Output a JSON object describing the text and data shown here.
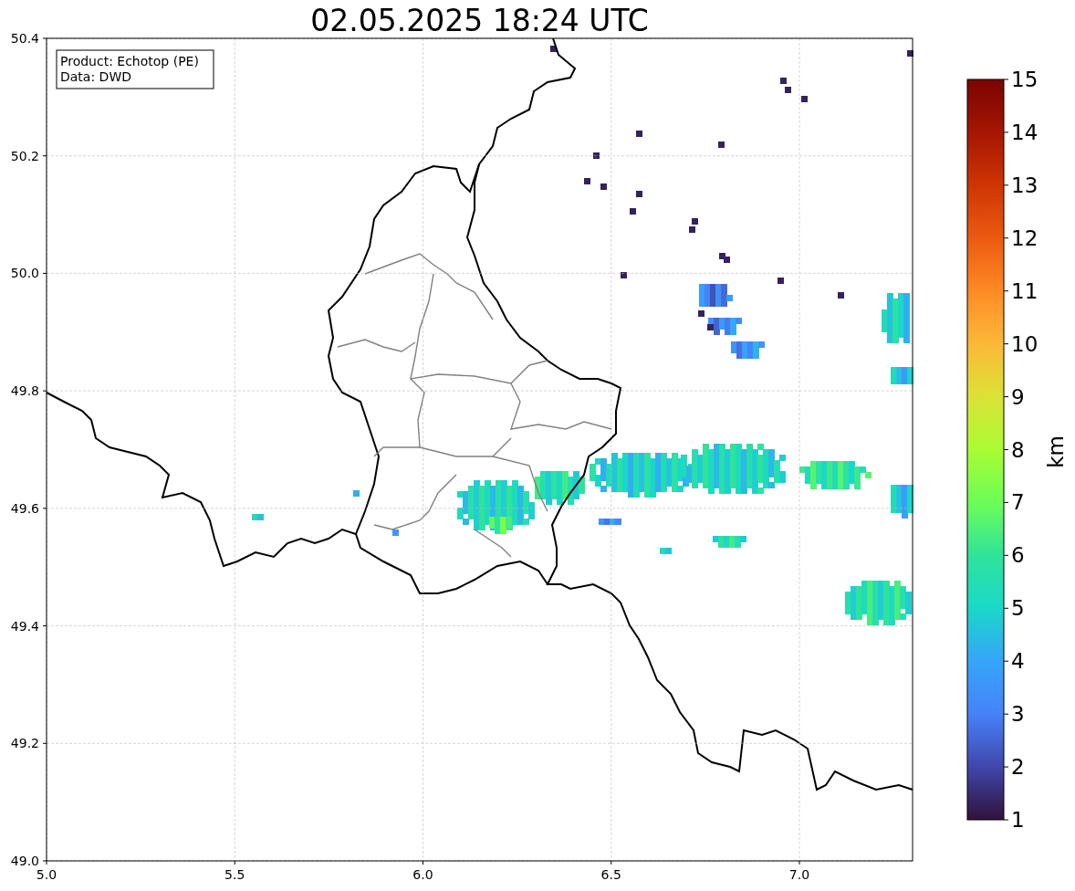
{
  "title": "02.05.2025 18:24 UTC",
  "info_box": {
    "lines": [
      "Product: Echotop (PE)",
      "Data: DWD"
    ]
  },
  "axes": {
    "xticks": [
      "5.0",
      "5.5",
      "6.0",
      "6.5",
      "7.0"
    ],
    "yticks": [
      "50.4",
      "50.2",
      "50.0",
      "49.8",
      "49.6",
      "49.4",
      "49.2",
      "49.0"
    ]
  },
  "colorbar": {
    "label": "km",
    "ticks": [
      "15",
      "14",
      "13",
      "12",
      "11",
      "10",
      "9",
      "8",
      "7",
      "6",
      "5",
      "4",
      "3",
      "2",
      "1"
    ]
  }
}
